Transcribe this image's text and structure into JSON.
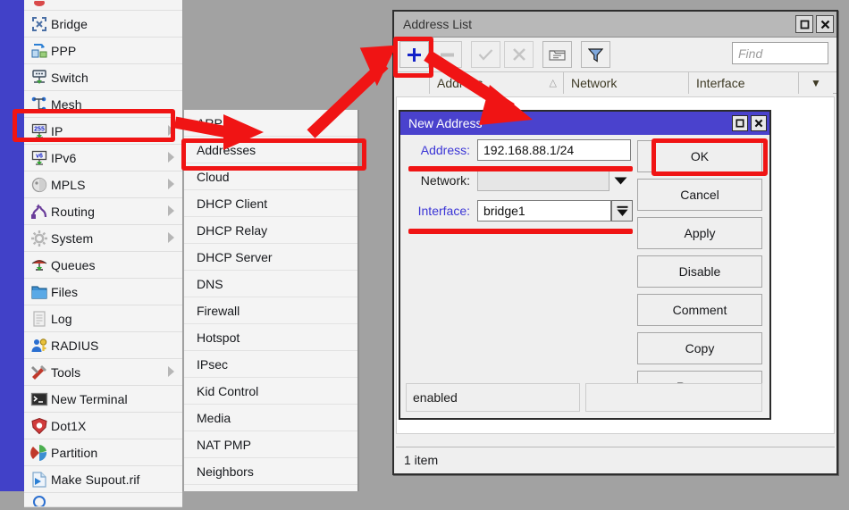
{
  "app": {
    "name": "WinBox",
    "background_color": "#a2a2a2",
    "accent_color": "#4141c8",
    "annotation_color": "#f01414"
  },
  "sidebar": {
    "items": [
      {
        "label": "Bridge",
        "icon": "bridge-icon",
        "has_submenu": false
      },
      {
        "label": "PPP",
        "icon": "ppp-icon",
        "has_submenu": false
      },
      {
        "label": "Switch",
        "icon": "switch-icon",
        "has_submenu": false
      },
      {
        "label": "Mesh",
        "icon": "mesh-icon",
        "has_submenu": false
      },
      {
        "label": "IP",
        "icon": "ip-icon",
        "has_submenu": true
      },
      {
        "label": "IPv6",
        "icon": "ipv6-icon",
        "has_submenu": true
      },
      {
        "label": "MPLS",
        "icon": "mpls-icon",
        "has_submenu": true
      },
      {
        "label": "Routing",
        "icon": "routing-icon",
        "has_submenu": true
      },
      {
        "label": "System",
        "icon": "system-icon",
        "has_submenu": true
      },
      {
        "label": "Queues",
        "icon": "queues-icon",
        "has_submenu": false
      },
      {
        "label": "Files",
        "icon": "files-icon",
        "has_submenu": false
      },
      {
        "label": "Log",
        "icon": "log-icon",
        "has_submenu": false
      },
      {
        "label": "RADIUS",
        "icon": "radius-icon",
        "has_submenu": false
      },
      {
        "label": "Tools",
        "icon": "tools-icon",
        "has_submenu": true
      },
      {
        "label": "New Terminal",
        "icon": "terminal-icon",
        "has_submenu": false
      },
      {
        "label": "Dot1X",
        "icon": "dot1x-icon",
        "has_submenu": false
      },
      {
        "label": "Partition",
        "icon": "partition-icon",
        "has_submenu": false
      },
      {
        "label": "Make Supout.rif",
        "icon": "make-supout-icon",
        "has_submenu": false
      }
    ]
  },
  "ip_submenu": {
    "items": [
      {
        "label": "ARP"
      },
      {
        "label": "Addresses"
      },
      {
        "label": "Cloud"
      },
      {
        "label": "DHCP Client"
      },
      {
        "label": "DHCP Relay"
      },
      {
        "label": "DHCP Server"
      },
      {
        "label": "DNS"
      },
      {
        "label": "Firewall"
      },
      {
        "label": "Hotspot"
      },
      {
        "label": "IPsec"
      },
      {
        "label": "Kid Control"
      },
      {
        "label": "Media"
      },
      {
        "label": "NAT PMP"
      },
      {
        "label": "Neighbors"
      }
    ]
  },
  "address_list_window": {
    "title": "Address List",
    "window_buttons": [
      {
        "name": "maximize",
        "glyph": "□"
      },
      {
        "name": "close",
        "glyph": "✕"
      }
    ],
    "toolbar": [
      {
        "name": "add",
        "icon": "plus-icon",
        "enabled": true
      },
      {
        "name": "remove",
        "icon": "minus-icon",
        "enabled": false
      },
      {
        "name": "enable",
        "icon": "check-icon",
        "enabled": false
      },
      {
        "name": "disable",
        "icon": "x-icon",
        "enabled": false
      },
      {
        "name": "comment",
        "icon": "comment-icon",
        "enabled": true
      },
      {
        "name": "filter",
        "icon": "funnel-icon",
        "enabled": true
      }
    ],
    "find_placeholder": "Find",
    "columns": [
      "Address",
      "Network",
      "Interface"
    ],
    "sort_indicator": "△",
    "column_menu_glyph": "▼",
    "status": "1 item"
  },
  "new_address_dialog": {
    "title": "New Address",
    "window_buttons": [
      {
        "name": "maximize",
        "glyph": "□"
      },
      {
        "name": "close",
        "glyph": "✕"
      }
    ],
    "fields": [
      {
        "label": "Address:",
        "value": "192.168.88.1/24",
        "highlighted": true,
        "control": "text"
      },
      {
        "label": "Network:",
        "value": "",
        "highlighted": false,
        "control": "dropdown"
      },
      {
        "label": "Interface:",
        "value": "bridge1",
        "highlighted": true,
        "control": "combo"
      }
    ],
    "buttons": [
      "OK",
      "Cancel",
      "Apply",
      "Disable",
      "Comment",
      "Copy",
      "Remove"
    ],
    "status": "enabled"
  },
  "annotations": {
    "highlight_boxes": [
      "sidebar-item-ip",
      "submenu-item-addresses",
      "toolbar-add-button",
      "ok-button"
    ],
    "underlines": [
      "address-field",
      "interface-field"
    ],
    "arrows": [
      "ip-to-addresses",
      "addresses-to-add-button",
      "add-button-to-new-address"
    ]
  }
}
